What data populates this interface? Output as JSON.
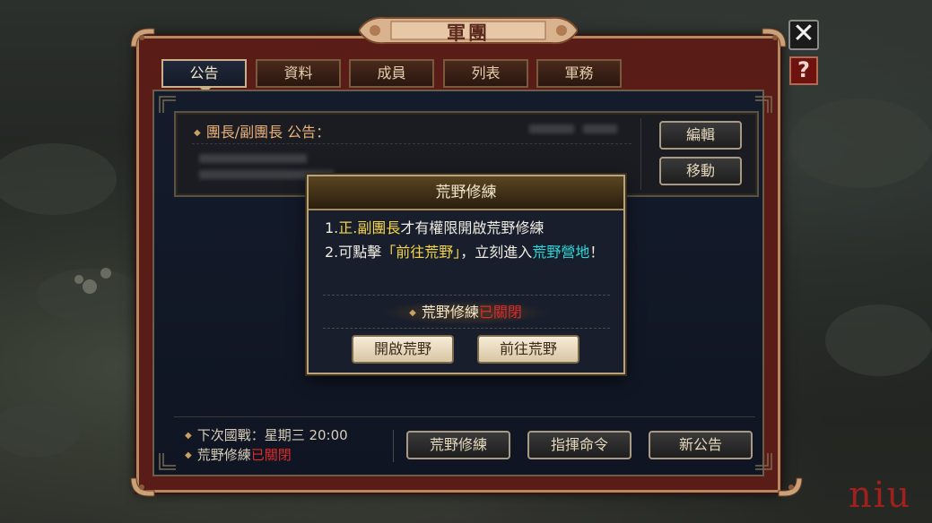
{
  "window": {
    "title": "軍團"
  },
  "controls": {
    "close_glyph": "✕",
    "help_glyph": "?"
  },
  "tabs": [
    {
      "label": "公告",
      "active": true
    },
    {
      "label": "資料",
      "active": false
    },
    {
      "label": "成員",
      "active": false
    },
    {
      "label": "列表",
      "active": false
    },
    {
      "label": "軍務",
      "active": false
    }
  ],
  "announcement": {
    "header": "團長/副團長 公告：",
    "edit_label": "編輯",
    "move_label": "移動"
  },
  "bottom": {
    "next_war_label": "下次國戰：星期三 20:00",
    "wild_training_label": "荒野修練",
    "wild_training_status": "已關閉",
    "buttons": [
      "荒野修練",
      "指揮命令",
      "新公告"
    ]
  },
  "modal": {
    "title": "荒野修練",
    "line1_prefix": "1.",
    "line1_highlight": "正.副團長",
    "line1_rest": "才有權限開啟荒野修練",
    "line2_prefix": "2.可點擊",
    "line2_highlight": "「前往荒野」",
    "line2_mid": "，立刻進入",
    "line2_cyan": "荒野營地",
    "line2_end": "！",
    "status_label": "荒野修練",
    "status_value": "已關閉",
    "open_button": "開啟荒野",
    "goto_button": "前往荒野"
  },
  "watermark": "niu",
  "colors": {
    "window_frame": "#5a1c17",
    "panel": "#141b2b",
    "accent_gold": "#f4d44a",
    "accent_cyan": "#2ed8d8",
    "closed_red": "#e02a2a"
  }
}
